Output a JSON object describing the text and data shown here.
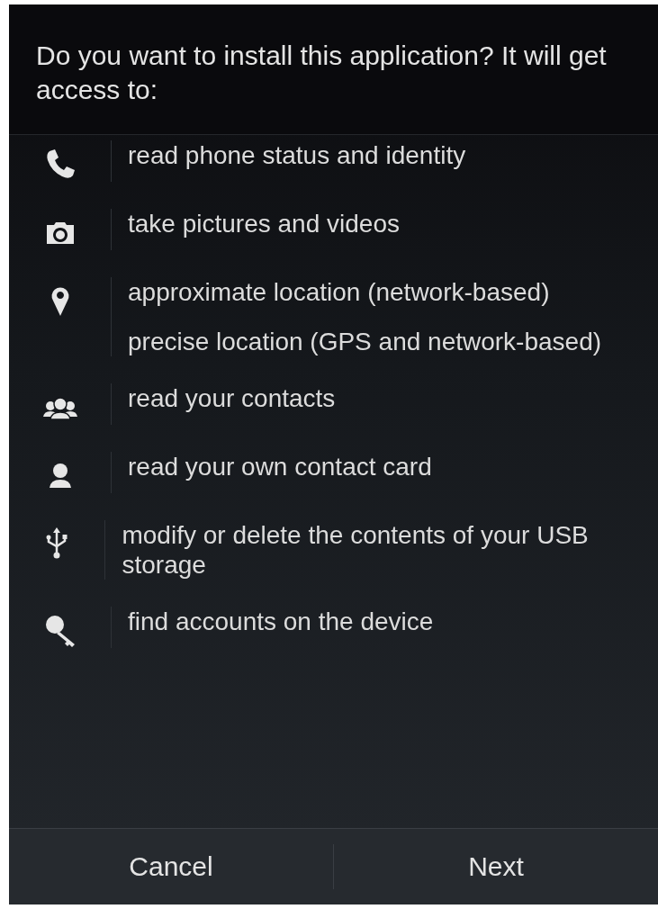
{
  "dialog": {
    "title": "Do you want to install this application? It will get access to:",
    "permission_groups": [
      {
        "kind": "phone",
        "permissions": [
          "read phone status and identity"
        ]
      },
      {
        "kind": "camera",
        "permissions": [
          "take pictures and videos"
        ]
      },
      {
        "kind": "location",
        "permissions": [
          "approximate location (network-based)",
          "precise location (GPS and network-based)"
        ]
      },
      {
        "kind": "contacts",
        "permissions": [
          "read your contacts"
        ]
      },
      {
        "kind": "person",
        "permissions": [
          "read your own contact card"
        ]
      },
      {
        "kind": "usb",
        "permissions": [
          "modify or delete the contents of your USB storage"
        ]
      },
      {
        "kind": "key",
        "permissions": [
          "find accounts on the device"
        ]
      }
    ],
    "buttons": [
      "Cancel",
      "Next"
    ]
  }
}
